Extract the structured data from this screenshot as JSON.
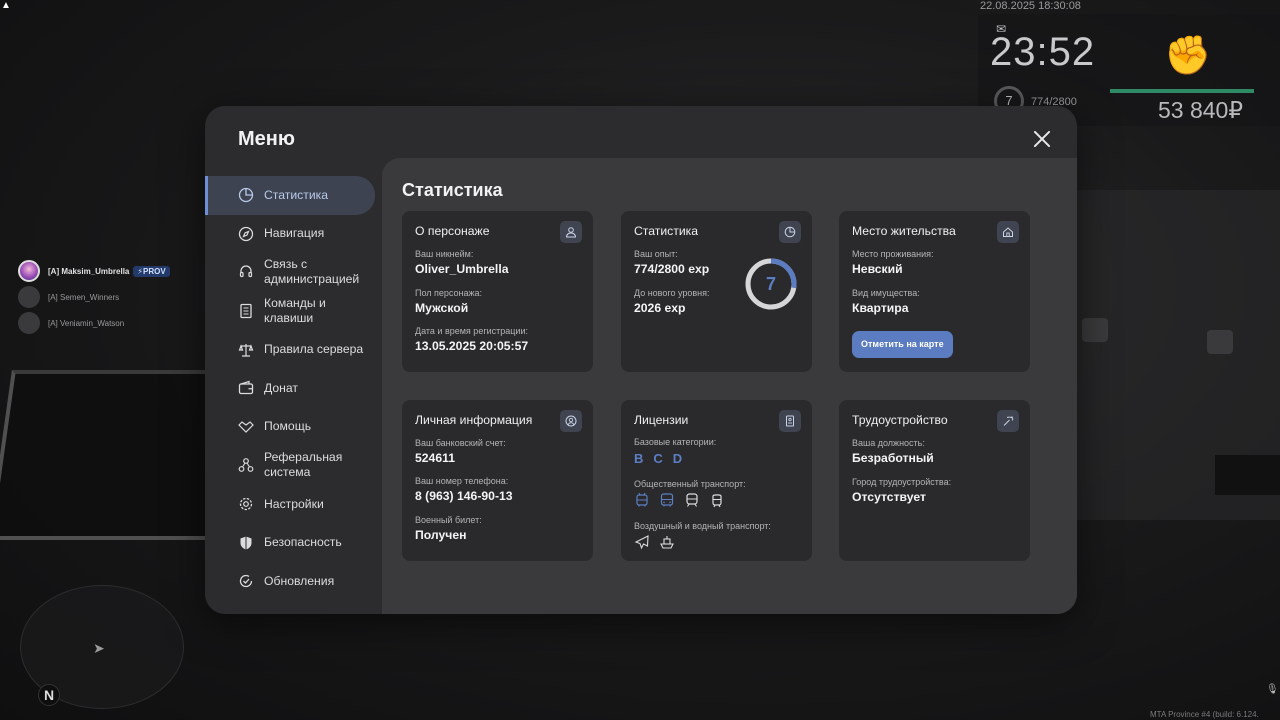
{
  "hud": {
    "datetime": "22.08.2025 18:30:08",
    "clock": "23:52",
    "level": "7",
    "exp": "774/2800",
    "money": "53 840₽"
  },
  "players": [
    {
      "name": "[A] Maksim_Umbrella",
      "badge": "⚡PROV"
    },
    {
      "name": "[A] Semen_Winners"
    },
    {
      "name": "[A] Veniamin_Watson"
    }
  ],
  "build": "MTA Province #4 (build: 6.124.",
  "menu": {
    "title": "Меню",
    "sidebar": [
      {
        "label": "Статистика",
        "icon": "pie-chart-icon",
        "active": true
      },
      {
        "label": "Навигация",
        "icon": "compass-icon"
      },
      {
        "label": "Связь с администрацией",
        "icon": "headset-icon"
      },
      {
        "label": "Команды и клавиши",
        "icon": "keyboard-doc-icon"
      },
      {
        "label": "Правила сервера",
        "icon": "scales-icon"
      },
      {
        "label": "Донат",
        "icon": "wallet-icon"
      },
      {
        "label": "Помощь",
        "icon": "handshake-icon"
      },
      {
        "label": "Реферальная система",
        "icon": "network-icon"
      },
      {
        "label": "Настройки",
        "icon": "gear-icon"
      },
      {
        "label": "Безопасность",
        "icon": "shield-icon"
      },
      {
        "label": "Обновления",
        "icon": "refresh-check-icon"
      }
    ],
    "content_title": "Статистика",
    "cards": {
      "character": {
        "title": "О персонаже",
        "nickname_label": "Ваш никнейм:",
        "nickname": "Oliver_Umbrella",
        "gender_label": "Пол персонажа:",
        "gender": "Мужской",
        "reg_label": "Дата и время регистрации:",
        "reg": "13.05.2025 20:05:57"
      },
      "stats": {
        "title": "Статистика",
        "exp_label": "Ваш опыт:",
        "exp": "774/2800 exp",
        "next_label": "До нового уровня:",
        "next": "2026 exp",
        "level": "7",
        "level_progress": 0.2764
      },
      "residence": {
        "title": "Место жительства",
        "place_label": "Место проживания:",
        "place": "Невский",
        "property_label": "Вид имущества:",
        "property": "Квартира",
        "button": "Отметить на карте"
      },
      "personal": {
        "title": "Личная информация",
        "bank_label": "Ваш банковский счет:",
        "bank": "524611",
        "phone_label": "Ваш номер телефона:",
        "phone": "8 (963) 146-90-13",
        "military_label": "Военный билет:",
        "military": "Получен"
      },
      "licenses": {
        "title": "Лицензии",
        "base_label": "Базовые категории:",
        "categories": [
          "B",
          "C",
          "D"
        ],
        "public_label": "Общественный транспорт:",
        "public_icons": [
          "trolleybus-icon",
          "bus-icon",
          "train-icon",
          "tram-icon"
        ],
        "airwater_label": "Воздушный и водный транспорт:",
        "airwater_icons": [
          "airplane-icon",
          "ship-icon"
        ]
      },
      "employment": {
        "title": "Трудоустройство",
        "position_label": "Ваша должность:",
        "position": "Безработный",
        "city_label": "Город трудоустройства:",
        "city": "Отсутствует"
      }
    }
  },
  "colors": {
    "accent": "#5b7cc1",
    "panel": "#2c2c2e",
    "content": "#3a3a3c",
    "card": "#2a2a2c",
    "hud_green": "#2e8a64"
  }
}
